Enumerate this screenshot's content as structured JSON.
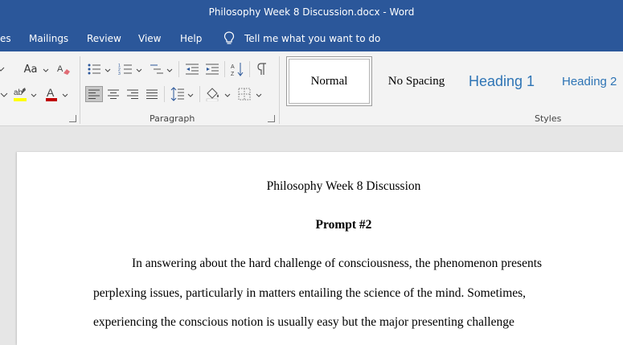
{
  "window": {
    "title": "Philosophy Week 8 Discussion.docx  -  Word"
  },
  "menu": {
    "items": [
      "es",
      "Mailings",
      "Review",
      "View",
      "Help"
    ],
    "tell_me": "Tell me what you want to do"
  },
  "ribbon": {
    "font_group": {
      "change_case": "Aa"
    },
    "paragraph_label": "Paragraph",
    "styles_label": "Styles",
    "styles": [
      "Normal",
      "No Spacing",
      "Heading 1",
      "Heading 2"
    ]
  },
  "document": {
    "title": "Philosophy Week 8 Discussion",
    "prompt": "Prompt #2",
    "lines": [
      "In answering about the hard challenge of consciousness, the phenomenon presents",
      "perplexing issues, particularly in matters entailing the science of the mind. Sometimes,",
      "experiencing the conscious notion is usually easy but the major presenting challenge"
    ]
  },
  "colors": {
    "title_bar": "#2b579a",
    "ribbon": "#f3f3f3",
    "heading_style": "#2e74b5",
    "highlight": "#ffff00",
    "font_color": "#c00000"
  }
}
